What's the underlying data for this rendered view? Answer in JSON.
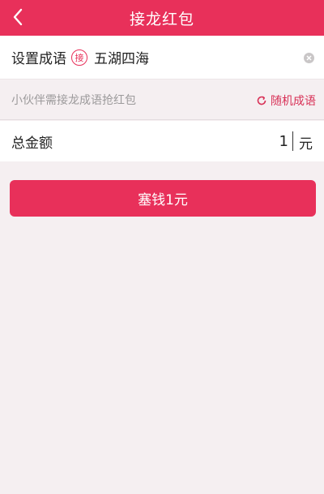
{
  "header": {
    "title": "接龙红包"
  },
  "idiom": {
    "label": "设置成语",
    "badge": "接",
    "value": "五湖四海"
  },
  "hint": {
    "text": "小伙伴需接龙成语抢红包",
    "random_label": "随机成语"
  },
  "amount": {
    "label": "总金额",
    "value": "1",
    "unit": "元"
  },
  "submit": {
    "label": "塞钱1元"
  },
  "colors": {
    "accent": "#e8305a",
    "background": "#f5eff1"
  }
}
